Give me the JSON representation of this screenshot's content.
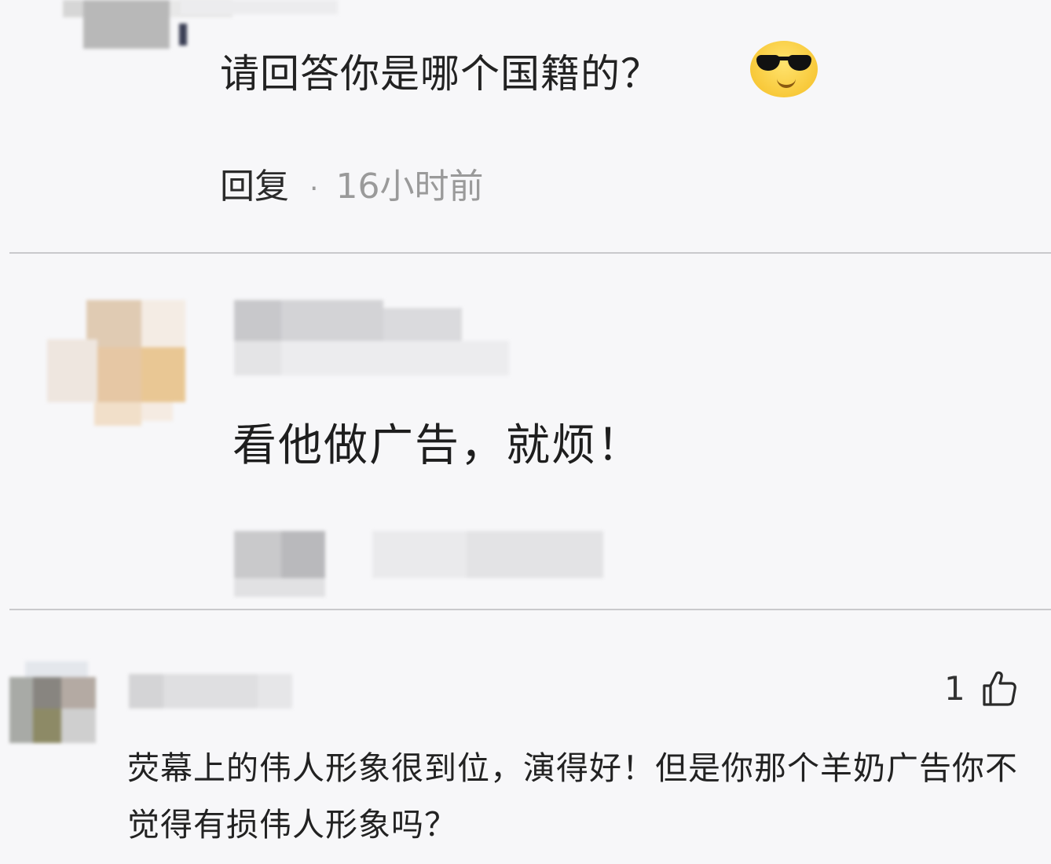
{
  "comments": [
    {
      "text": "请回答你是哪个国籍的？",
      "emoji": "sunglasses-emoji",
      "reply_label": "回复",
      "separator": "·",
      "time": "16小时前"
    },
    {
      "text": "看他做广告，就烦！"
    },
    {
      "likes": "1",
      "like_icon": "thumbs-up-icon",
      "text": "荧幕上的伟人形象很到位，演得好！但是你那个羊奶广告你不觉得有损伟人形象吗？"
    }
  ],
  "colors": {
    "background": "#f7f7f9",
    "divider": "#c9c9cc",
    "meta_text": "#9a9a9a"
  }
}
